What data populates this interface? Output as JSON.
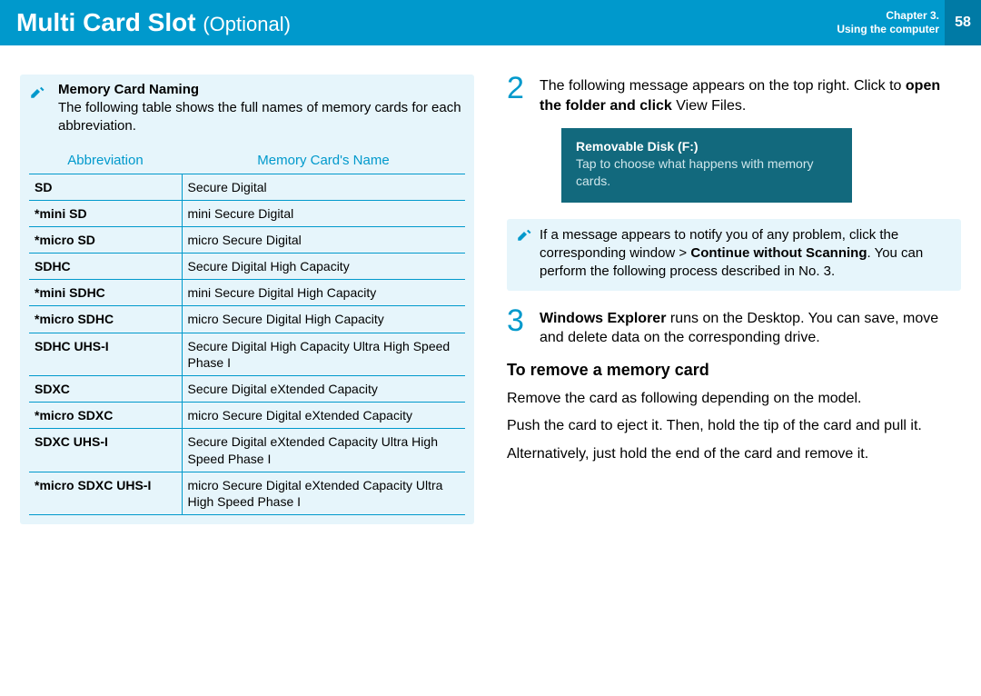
{
  "header": {
    "title_main": "Multi Card Slot",
    "title_optional": "(Optional)",
    "chapter_line1": "Chapter 3.",
    "chapter_line2": "Using the computer",
    "page_number": "58"
  },
  "left": {
    "note_heading": "Memory Card Naming",
    "note_body": "The following table shows the full names of memory cards for each abbreviation.",
    "table_header_left": "Abbreviation",
    "table_header_right": "Memory Card's Name",
    "rows": [
      {
        "abbr": "SD",
        "name": "Secure Digital"
      },
      {
        "abbr": "*mini SD",
        "name": "mini Secure Digital"
      },
      {
        "abbr": "*micro SD",
        "name": "micro Secure Digital"
      },
      {
        "abbr": "SDHC",
        "name": "Secure Digital High Capacity"
      },
      {
        "abbr": "*mini SDHC",
        "name": "mini Secure Digital High Capacity"
      },
      {
        "abbr": "*micro SDHC",
        "name": "micro Secure Digital High Capacity"
      },
      {
        "abbr": "SDHC UHS-I",
        "name": "Secure Digital High Capacity Ultra High Speed Phase I"
      },
      {
        "abbr": "SDXC",
        "name": "Secure Digital eXtended Capacity"
      },
      {
        "abbr": "*micro SDXC",
        "name": "micro Secure Digital eXtended Capacity"
      },
      {
        "abbr": "SDXC UHS-I",
        "name": "Secure Digital eXtended Capacity Ultra High Speed Phase I"
      },
      {
        "abbr": "*micro SDXC UHS-I",
        "name": "micro Secure Digital eXtended Capacity Ultra High Speed Phase I"
      }
    ]
  },
  "right": {
    "step2_num": "2",
    "step2_a": "The following message appears on the top right. Click to ",
    "step2_b": "open the folder and click",
    "step2_c": " View Files.",
    "toast_title": "Removable Disk (F:)",
    "toast_body": "Tap to choose what happens with memory cards.",
    "note2_a": "If a message appears to notify you of any problem, click the corresponding window > ",
    "note2_b": "Continue without Scanning",
    "note2_c": ". You can perform the following process described in No. 3.",
    "step3_num": "3",
    "step3_a": "Windows Explorer",
    "step3_b": " runs on the Desktop. You can save, move and delete data on the corresponding drive.",
    "section_heading": "To remove a memory card",
    "para1": "Remove the card as following depending on the model.",
    "para2": "Push the card to eject it. Then, hold the tip of the card and pull it.",
    "para3": "Alternatively, just hold the end of the card and remove it."
  }
}
